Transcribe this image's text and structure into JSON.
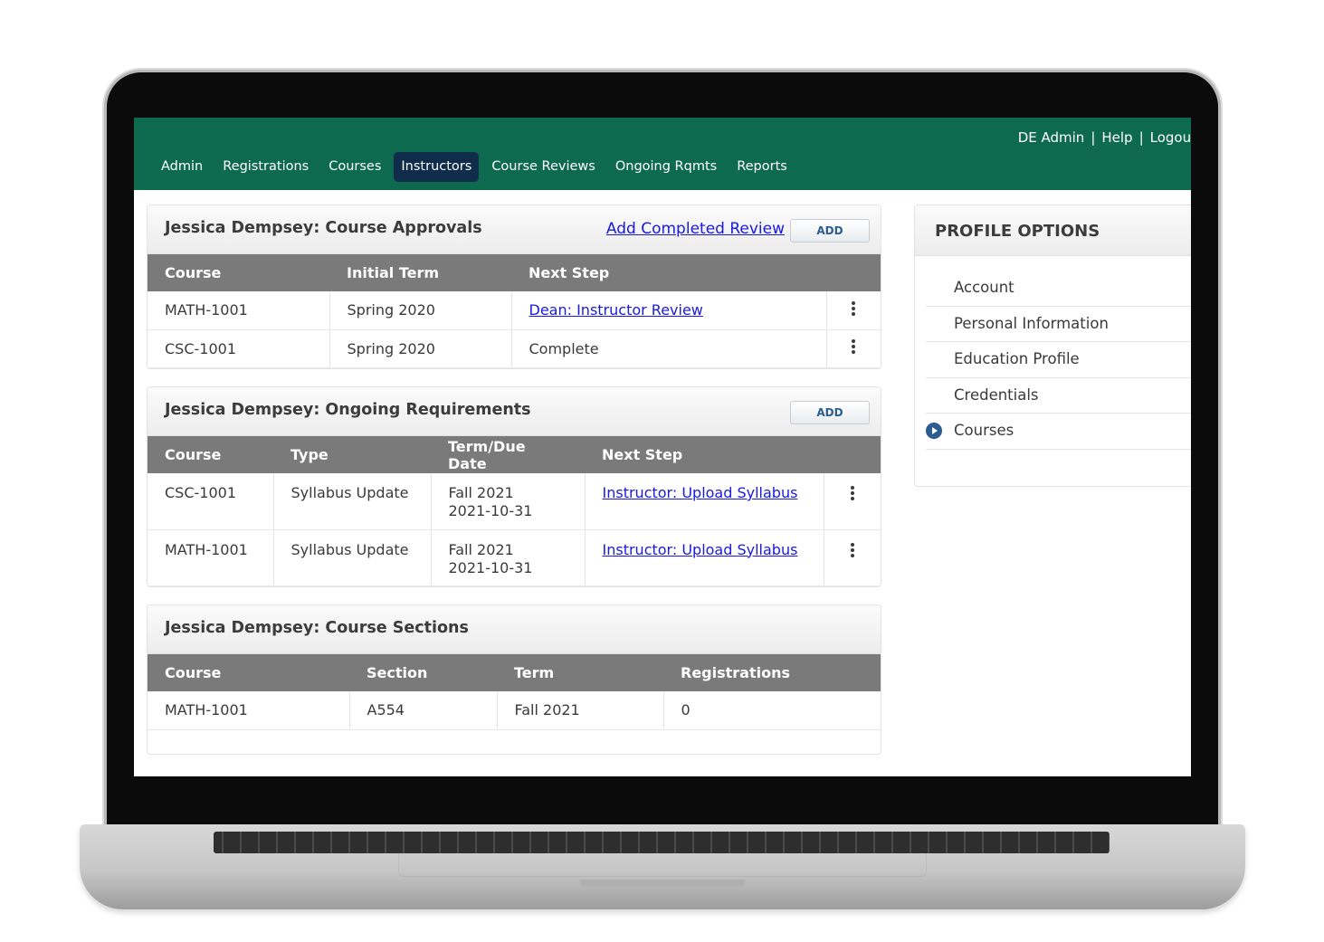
{
  "header": {
    "user_links": [
      "DE Admin",
      "Help",
      "Logout"
    ],
    "separator": "|",
    "nav": [
      "Admin",
      "Registrations",
      "Courses",
      "Instructors",
      "Course Reviews",
      "Ongoing Rqmts",
      "Reports"
    ],
    "active_nav": "Instructors"
  },
  "approvals": {
    "title": "Jessica Dempsey: Course Approvals",
    "link": "Add Completed Review",
    "add_label": "ADD",
    "columns": [
      "Course",
      "Initial Term",
      "Next Step"
    ],
    "rows": [
      {
        "course": "MATH-1001",
        "term": "Spring 2020",
        "next": "Dean: Instructor Review",
        "next_is_link": true
      },
      {
        "course": "CSC-1001",
        "term": "Spring 2020",
        "next": "Complete",
        "next_is_link": false
      }
    ]
  },
  "requirements": {
    "title": "Jessica Dempsey: Ongoing Requirements",
    "add_label": "ADD",
    "columns": [
      "Course",
      "Type",
      "Term/Due Date",
      "Next Step"
    ],
    "rows": [
      {
        "course": "CSC-1001",
        "type": "Syllabus Update",
        "term": "Fall 2021",
        "due": "2021-10-31",
        "next": "Instructor: Upload Syllabus"
      },
      {
        "course": "MATH-1001",
        "type": "Syllabus Update",
        "term": "Fall 2021",
        "due": "2021-10-31",
        "next": "Instructor: Upload Syllabus"
      }
    ]
  },
  "sections": {
    "title": "Jessica Dempsey: Course Sections",
    "columns": [
      "Course",
      "Section",
      "Term",
      "Registrations"
    ],
    "rows": [
      {
        "course": "MATH-1001",
        "section": "A554",
        "term": "Fall 2021",
        "registrations": "0"
      }
    ]
  },
  "sidebar": {
    "title": "PROFILE OPTIONS",
    "items": [
      "Account",
      "Personal Information",
      "Education Profile",
      "Credentials",
      "Courses"
    ],
    "active": "Courses"
  },
  "colors": {
    "header_green": "#0e6a4e",
    "active_nav": "#0f2c4a",
    "table_header": "#7a7a7a",
    "link_blue": "#1a1adb",
    "bullet_blue": "#2b5b8f"
  }
}
